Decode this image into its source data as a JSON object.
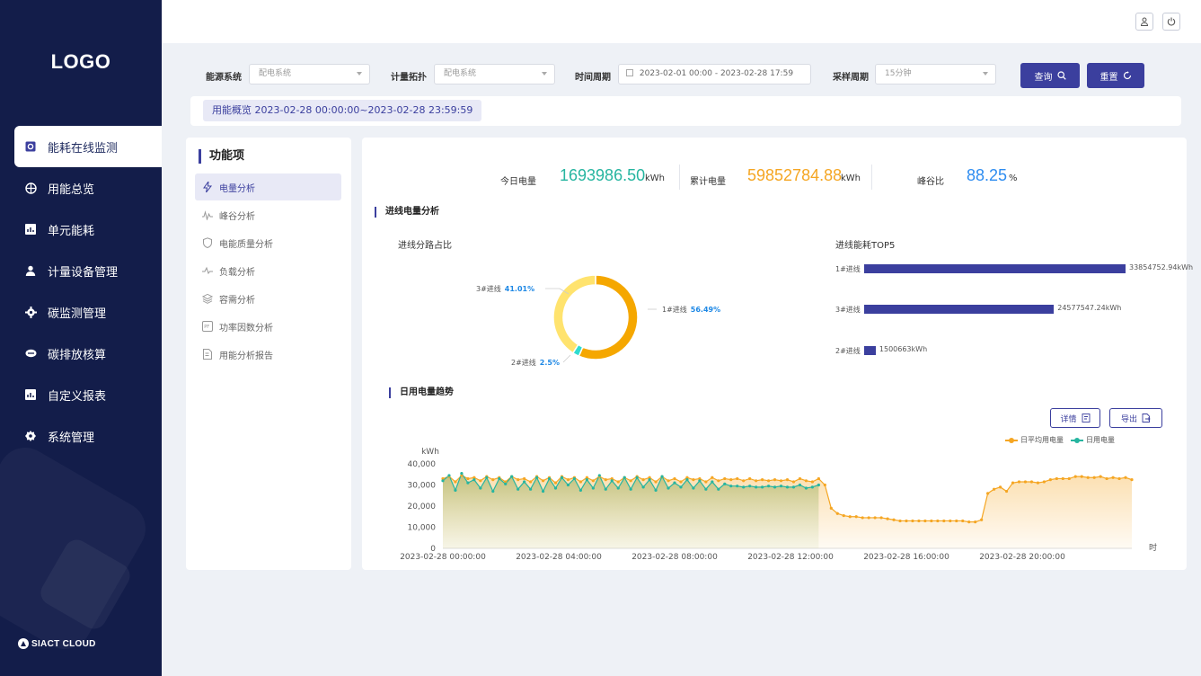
{
  "sidebar": {
    "logo": "LOGO",
    "items": [
      {
        "label": "能耗在线监测",
        "icon": "monitor-icon",
        "active": true
      },
      {
        "label": "用能总览",
        "icon": "globe-icon"
      },
      {
        "label": "单元能耗",
        "icon": "chart-icon"
      },
      {
        "label": "计量设备管理",
        "icon": "user-icon"
      },
      {
        "label": "碳监测管理",
        "icon": "gear-icon"
      },
      {
        "label": "碳排放核算",
        "icon": "cloud-icon"
      },
      {
        "label": "自定义报表",
        "icon": "report-icon"
      },
      {
        "label": "系统管理",
        "icon": "settings-icon"
      }
    ],
    "brand": "SIACT CLOUD"
  },
  "header": {
    "user_icon": "user-icon",
    "power_icon": "power-icon"
  },
  "filter": {
    "energy_system_label": "能源系统",
    "energy_system_value": "配电系统",
    "topology_label": "计量拓扑",
    "topology_value": "配电系统",
    "time_label": "时间周期",
    "time_value": "2023-02-01 00:00 - 2023-02-28 17:59",
    "sample_label": "采样周期",
    "sample_value": "15分钟",
    "query_label": "查询",
    "reset_label": "重置"
  },
  "overview_tag": "用能概览 2023-02-28 00:00:00~2023-02-28 23:59:59",
  "func_panel": {
    "title": "功能项",
    "items": [
      {
        "label": "电量分析",
        "icon": "lightning-icon",
        "active": true
      },
      {
        "label": "峰谷分析",
        "icon": "wave-icon"
      },
      {
        "label": "电能质量分析",
        "icon": "shield-icon"
      },
      {
        "label": "负载分析",
        "icon": "load-icon"
      },
      {
        "label": "容需分析",
        "icon": "layers-icon"
      },
      {
        "label": "功率因数分析",
        "icon": "pf-icon"
      },
      {
        "label": "用能分析报告",
        "icon": "document-icon"
      }
    ]
  },
  "stats": {
    "today_label": "今日电量",
    "today_value": "1693986.50",
    "today_unit": "kWh",
    "total_label": "累计电量",
    "total_value": "59852784.88",
    "total_unit": "kWh",
    "ratio_label": "峰谷比",
    "ratio_value": "88.25",
    "ratio_unit": "%"
  },
  "colors": {
    "primary": "#3b3f9e",
    "teal": "#26b5a0",
    "orange": "#f5a623",
    "blue": "#2d8cf0"
  },
  "section_incoming": "进线电量分析",
  "section_daily": "日用电量趋势",
  "donut": {
    "title": "进线分路占比",
    "slices": [
      {
        "name": "1#进线",
        "pct": 56.49,
        "pct_label": "56.49%",
        "color": "#f5a700"
      },
      {
        "name": "2#进线",
        "pct": 2.5,
        "pct_label": "2.5%",
        "color": "#2fdcd0"
      },
      {
        "name": "3#进线",
        "pct": 41.01,
        "pct_label": "41.01%",
        "color": "#ffe36e"
      }
    ]
  },
  "top5": {
    "title": "进线能耗TOP5",
    "bars": [
      {
        "name": "1#进线",
        "value": 33854752.94,
        "label": "33854752.94kWh"
      },
      {
        "name": "3#进线",
        "value": 24577547.24,
        "label": "24577547.24kWh"
      },
      {
        "name": "2#进线",
        "value": 1500663,
        "label": "1500663kWh"
      }
    ]
  },
  "trend_buttons": {
    "detail_label": "详情",
    "export_label": "导出"
  },
  "chart_data": {
    "type": "area",
    "ylabel": "kWh",
    "xlabel": "时",
    "ylim": [
      0,
      40000
    ],
    "yticks": [
      "40,000",
      "30,000",
      "20,000",
      "10,000",
      "0"
    ],
    "xticks": [
      "2023-02-28 00:00:00",
      "2023-02-28 04:00:00",
      "2023-02-28 08:00:00",
      "2023-02-28 12:00:00",
      "2023-02-28 16:00:00",
      "2023-02-28 20:00:00"
    ],
    "legend": [
      "日平均用电量",
      "日用电量"
    ],
    "series": [
      {
        "name": "日平均用电量",
        "color": "#f5a623",
        "values": [
          33000,
          34000,
          31500,
          34500,
          33000,
          33500,
          32000,
          34000,
          32500,
          33500,
          31500,
          34000,
          32500,
          33000,
          31500,
          34000,
          32000,
          33500,
          31000,
          34000,
          32500,
          33500,
          31500,
          33500,
          32000,
          34000,
          32500,
          33000,
          31500,
          33500,
          32000,
          34000,
          32500,
          33500,
          31500,
          34000,
          32000,
          33000,
          31500,
          33500,
          32500,
          33000,
          31500,
          33500,
          32000,
          33000,
          32500,
          33000,
          32000,
          33000,
          32000,
          32500,
          32000,
          32500,
          32000,
          32500,
          31500,
          33000,
          32000,
          31500,
          33000,
          30000,
          19000,
          16500,
          15500,
          15000,
          15000,
          14500,
          14500,
          14500,
          14500,
          14000,
          13500,
          13000,
          13000,
          13000,
          13000,
          13000,
          13000,
          13000,
          13000,
          13000,
          13000,
          13000,
          12500,
          12500,
          13500,
          26000,
          28000,
          29000,
          27000,
          31000,
          31500,
          31500,
          31500,
          31000,
          31500,
          32500,
          33000,
          33000,
          33000,
          34000,
          34000,
          33500,
          33500,
          34000,
          33000,
          33500,
          33000,
          33500,
          32500
        ]
      },
      {
        "name": "日用电量",
        "color": "#26b5a0",
        "values": [
          32000,
          34500,
          27500,
          35500,
          31000,
          32500,
          28500,
          33500,
          27000,
          33000,
          30500,
          34000,
          28000,
          31500,
          28000,
          33500,
          27000,
          33000,
          28500,
          33500,
          30000,
          33000,
          27500,
          32500,
          28500,
          34500,
          28000,
          32000,
          28500,
          33500,
          28000,
          33500,
          29000,
          32500,
          27500,
          34000,
          28500,
          31000,
          29000,
          32500,
          28500,
          32000,
          28000,
          31500,
          28000,
          30500,
          29500,
          29500,
          29000,
          29500,
          29000,
          29000,
          29500,
          29000,
          29500,
          29000,
          29000,
          30000,
          28500,
          29000,
          30000
        ]
      }
    ]
  }
}
